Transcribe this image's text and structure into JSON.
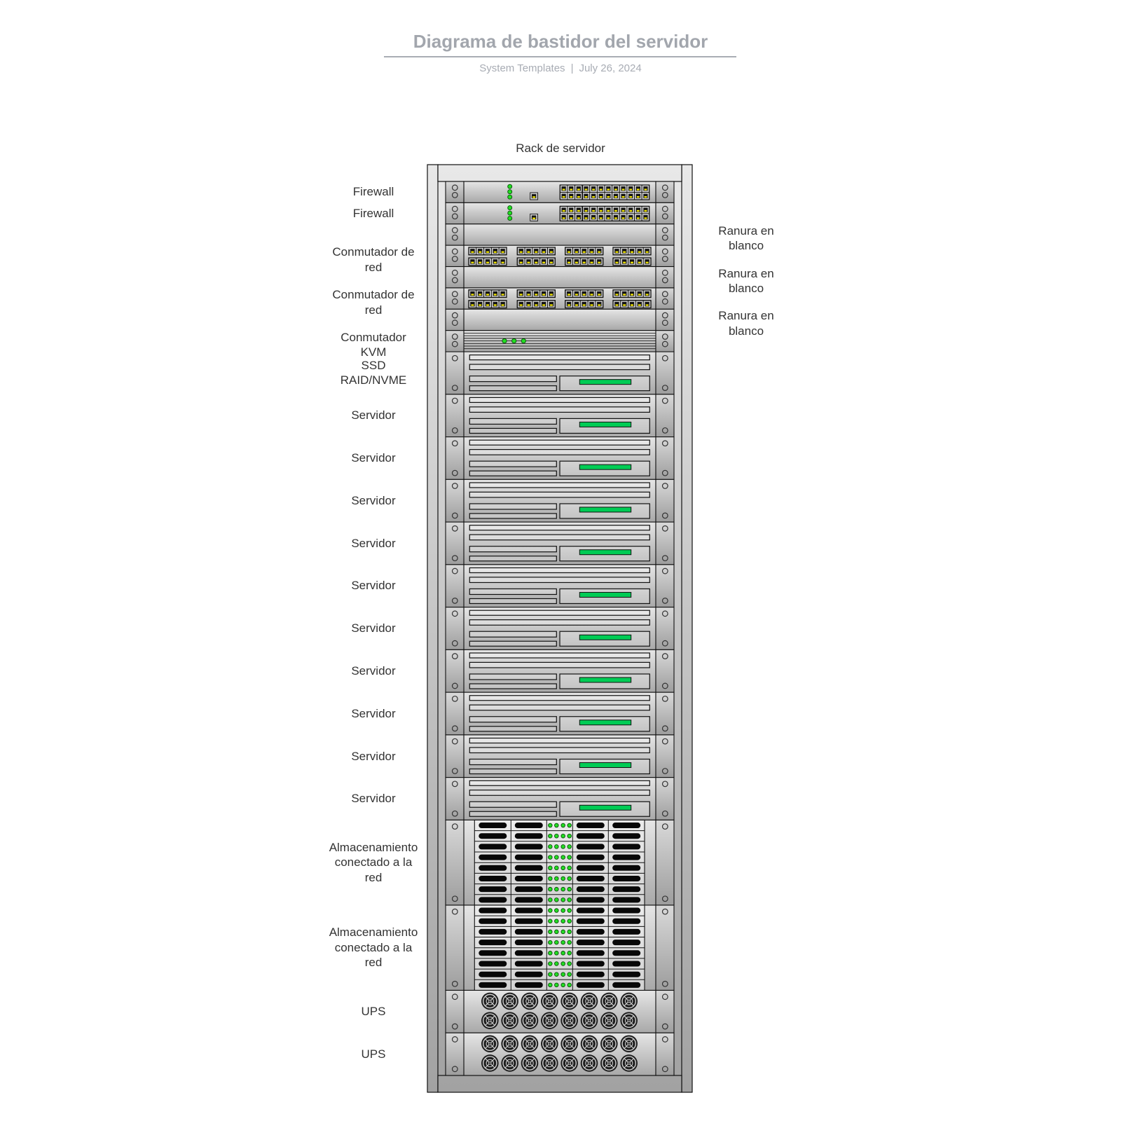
{
  "header": {
    "title": "Diagrama de bastidor del servidor",
    "source": "System Templates",
    "separator": "|",
    "date": "July 26, 2024"
  },
  "rack": {
    "title": "Rack de servidor",
    "total_units": 42,
    "devices": [
      {
        "type": "firewall",
        "u": 1,
        "label": "Firewall",
        "label_side": "left"
      },
      {
        "type": "firewall",
        "u": 1,
        "label": "Firewall",
        "label_side": "left"
      },
      {
        "type": "blank",
        "u": 1,
        "label": "Ranura en blanco",
        "label_side": "right"
      },
      {
        "type": "switch",
        "u": 1,
        "label": "Conmutador de red",
        "label_side": "left"
      },
      {
        "type": "blank",
        "u": 1,
        "label": "Ranura en blanco",
        "label_side": "right"
      },
      {
        "type": "switch",
        "u": 1,
        "label": "Conmutador de red",
        "label_side": "left"
      },
      {
        "type": "blank",
        "u": 1,
        "label": "Ranura en blanco",
        "label_side": "right"
      },
      {
        "type": "kvm",
        "u": 1,
        "label": "Conmutador KVM",
        "label_side": "left"
      },
      {
        "type": "server",
        "u": 2,
        "label": "SSD RAID/NVME",
        "label_side": "left"
      },
      {
        "type": "server",
        "u": 2,
        "label": "Servidor",
        "label_side": "left"
      },
      {
        "type": "server",
        "u": 2,
        "label": "Servidor",
        "label_side": "left"
      },
      {
        "type": "server",
        "u": 2,
        "label": "Servidor",
        "label_side": "left"
      },
      {
        "type": "server",
        "u": 2,
        "label": "Servidor",
        "label_side": "left"
      },
      {
        "type": "server",
        "u": 2,
        "label": "Servidor",
        "label_side": "left"
      },
      {
        "type": "server",
        "u": 2,
        "label": "Servidor",
        "label_side": "left"
      },
      {
        "type": "server",
        "u": 2,
        "label": "Servidor",
        "label_side": "left"
      },
      {
        "type": "server",
        "u": 2,
        "label": "Servidor",
        "label_side": "left"
      },
      {
        "type": "server",
        "u": 2,
        "label": "Servidor",
        "label_side": "left"
      },
      {
        "type": "server",
        "u": 2,
        "label": "Servidor",
        "label_side": "left"
      },
      {
        "type": "nas",
        "u": 4,
        "label": "Almacenamiento conectado a la red",
        "label_side": "left"
      },
      {
        "type": "nas",
        "u": 4,
        "label": "Almacenamiento conectado a la red",
        "label_side": "left"
      },
      {
        "type": "ups",
        "u": 2,
        "label": "UPS",
        "label_side": "left"
      },
      {
        "type": "ups",
        "u": 2,
        "label": "UPS",
        "label_side": "left"
      }
    ]
  },
  "device_specs": {
    "firewall": {
      "status_leds": 3,
      "uplink_ports": 1,
      "ethernet_ports": 24
    },
    "switch": {
      "ethernet_ports": 40,
      "port_groups": 8
    },
    "kvm": {
      "status_leds": 3
    },
    "server": {
      "drive_bays": 4,
      "status_indicators": 1
    },
    "nas": {
      "drive_bays": 32,
      "activity_leds": 32
    },
    "ups": {
      "fans": 16
    }
  },
  "colors": {
    "title": "#a2a6ad",
    "led_green": "#22dd22",
    "status_green": "#00cc55",
    "port_yellow": "#f2e600",
    "label_text": "#333333"
  }
}
